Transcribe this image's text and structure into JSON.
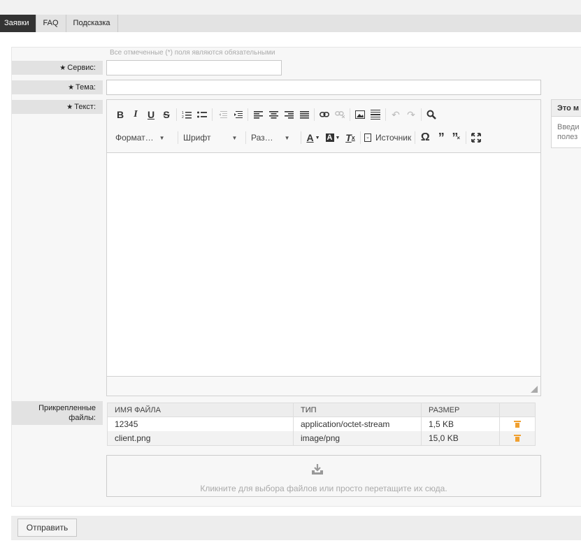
{
  "nav": {
    "tabs": [
      "Заявки",
      "FAQ",
      "Подсказка"
    ]
  },
  "form": {
    "required_hint": "Все отмеченные (*) поля являются обязательными",
    "service_label": "Сервис:",
    "subject_label": "Тема:",
    "text_label": "Текст:",
    "attachments_label_line1": "Прикрепленные",
    "attachments_label_line2": "файлы:",
    "required_star": "★"
  },
  "editor": {
    "format_label": "Формат…",
    "font_label": "Шрифт",
    "size_label": "Раз…",
    "source_label": "Источник"
  },
  "sidebox": {
    "title": "Это м",
    "line1": "Введи",
    "line2": "полез"
  },
  "files": {
    "columns": [
      "ИМЯ ФАЙЛА",
      "ТИП",
      "РАЗМЕР"
    ],
    "rows": [
      {
        "name": "12345",
        "type": "application/octet-stream",
        "size": "1,5 KB"
      },
      {
        "name": "client.png",
        "type": "image/png",
        "size": "15,0 KB"
      }
    ]
  },
  "dropzone": {
    "text": "Кликните для выбора файлов или просто перетащите их сюда."
  },
  "actions": {
    "submit_label": "Отправить"
  }
}
